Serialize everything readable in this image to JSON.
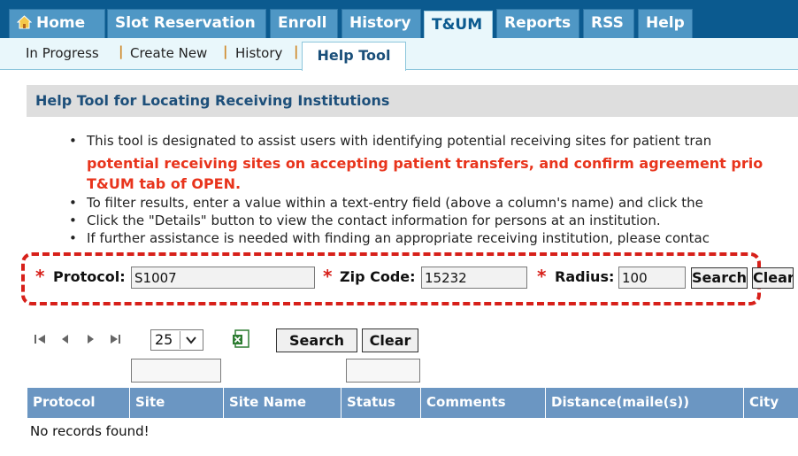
{
  "nav": {
    "tabs": [
      {
        "label": "Home",
        "icon": "home-icon"
      },
      {
        "label": "Slot Reservation"
      },
      {
        "label": "Enroll"
      },
      {
        "label": "History"
      },
      {
        "label": "T&UM",
        "active": true
      },
      {
        "label": "Reports"
      },
      {
        "label": "RSS"
      },
      {
        "label": "Help"
      }
    ]
  },
  "subnav": {
    "items": [
      "In Progress",
      "Create New",
      "History"
    ],
    "active": "Help Tool"
  },
  "section": {
    "title": "Help Tool for Locating Receiving Institutions"
  },
  "bullets": {
    "b1": "This tool is designated to assist users with identifying potential receiving sites for patient tran",
    "b1_red1": "potential receiving sites on accepting patient transfers, and confirm agreement prio",
    "b1_red2": "T&UM tab of OPEN.",
    "b2": "To filter results, enter a value within a text-entry field (above a column's name) and click the",
    "b3": "Click the \"Details\" button to view the contact information for persons at an institution.",
    "b4": "If further assistance is needed with finding an appropriate receiving institution, please contac"
  },
  "search": {
    "required_mark": "*",
    "protocol_label": "Protocol:",
    "protocol_value": "S1007",
    "zip_label": "Zip Code:",
    "zip_value": "15232",
    "radius_label": "Radius:",
    "radius_value": "100",
    "search_label": "Search",
    "clear_label": "Clear"
  },
  "grid": {
    "page_size": "25",
    "search_label": "Search",
    "clear_label": "Clear",
    "columns": [
      "Protocol",
      "Site",
      "Site Name",
      "Status",
      "Comments",
      "Distance(maile(s))",
      "City"
    ],
    "empty_message": "No records found!"
  },
  "colors": {
    "nav_bg": "#0b5a8f",
    "tab_bg": "#4f97c5",
    "header_bg": "#6b96c2",
    "alert_red": "#e8341c",
    "highlight_dash": "#d7201a"
  }
}
